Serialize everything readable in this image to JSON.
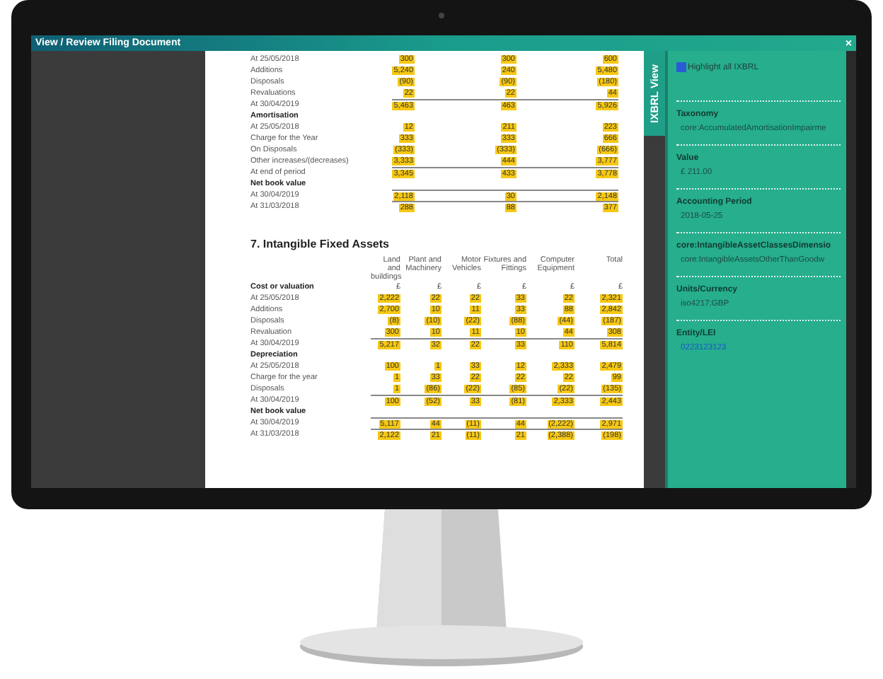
{
  "window": {
    "title": "View / Review Filing Document",
    "close": "×"
  },
  "document": {
    "table_1": {
      "rows": [
        {
          "kind": "value",
          "label": "At 25/05/2018",
          "values": [
            "300",
            "300",
            "600"
          ]
        },
        {
          "kind": "value",
          "label": "Additions",
          "values": [
            "5,240",
            "240",
            "5,480"
          ]
        },
        {
          "kind": "value",
          "label": "Disposals",
          "values": [
            "(90)",
            "(90)",
            "(180)"
          ]
        },
        {
          "kind": "value",
          "label": "Revaluations",
          "values": [
            "22",
            "22",
            "44"
          ]
        },
        {
          "kind": "total",
          "label": "At 30/04/2019",
          "values": [
            "5,463",
            "463",
            "5,926"
          ]
        },
        {
          "kind": "heading",
          "label": "Amortisation",
          "values": []
        },
        {
          "kind": "value",
          "label": "At 25/05/2018",
          "values": [
            "12",
            "211",
            "223"
          ]
        },
        {
          "kind": "value",
          "label": "Charge for the Year",
          "values": [
            "333",
            "333",
            "666"
          ]
        },
        {
          "kind": "value",
          "label": "On Disposals",
          "values": [
            "(333)",
            "(333)",
            "(666)"
          ]
        },
        {
          "kind": "value",
          "label": "Other increases/(decreases)",
          "values": [
            "3,333",
            "444",
            "3,777"
          ]
        },
        {
          "kind": "total",
          "label": "At end of period",
          "values": [
            "3,345",
            "433",
            "3,778"
          ]
        },
        {
          "kind": "heading",
          "label": "Net book value",
          "values": []
        },
        {
          "kind": "total",
          "label": "At 30/04/2019",
          "values": [
            "2,118",
            "30",
            "2,148"
          ]
        },
        {
          "kind": "total",
          "label": "At 31/03/2018",
          "values": [
            "288",
            "88",
            "377"
          ]
        }
      ]
    },
    "section_heading": "7. Intangible Fixed Assets",
    "table_2": {
      "columns": [
        "Land and buildings",
        "Plant and Machinery",
        "Motor Vehicles",
        "Fixtures and Fittings",
        "Computer Equipment",
        "Total"
      ],
      "rows": [
        {
          "kind": "heading",
          "label": "Cost or valuation",
          "values": [
            "£",
            "£",
            "£",
            "£",
            "£",
            "£"
          ]
        },
        {
          "kind": "value",
          "label": "At 25/05/2018",
          "values": [
            "2,222",
            "22",
            "22",
            "33",
            "22",
            "2,321"
          ]
        },
        {
          "kind": "value",
          "label": "Additions",
          "values": [
            "2,700",
            "10",
            "11",
            "33",
            "88",
            "2,842"
          ]
        },
        {
          "kind": "value",
          "label": "Disposals",
          "values": [
            "(8)",
            "(10)",
            "(22)",
            "(88)",
            "(44)",
            "(187)"
          ]
        },
        {
          "kind": "value",
          "label": "Revaluation",
          "values": [
            "300",
            "10",
            "11",
            "10",
            "44",
            "308"
          ]
        },
        {
          "kind": "total",
          "label": "At 30/04/2019",
          "values": [
            "5,217",
            "32",
            "22",
            "33",
            "110",
            "5,814"
          ]
        },
        {
          "kind": "heading",
          "label": "Depreciation",
          "values": []
        },
        {
          "kind": "value",
          "label": "At 25/05/2018",
          "values": [
            "100",
            "1",
            "33",
            "12",
            "2,333",
            "2,479"
          ]
        },
        {
          "kind": "value",
          "label": "Charge for the year",
          "values": [
            "1",
            "33",
            "22",
            "22",
            "22",
            "99"
          ]
        },
        {
          "kind": "value",
          "label": "Disposals",
          "values": [
            "1",
            "(86)",
            "(22)",
            "(85)",
            "(22)",
            "(135)"
          ]
        },
        {
          "kind": "total",
          "label": "At 30/04/2019",
          "values": [
            "100",
            "(52)",
            "33",
            "(81)",
            "2,333",
            "2,443"
          ]
        },
        {
          "kind": "heading",
          "label": "Net book value",
          "values": []
        },
        {
          "kind": "total",
          "label": "At 30/04/2019",
          "values": [
            "5,117",
            "44",
            "(11)",
            "44",
            "(2,222)",
            "2,971"
          ]
        },
        {
          "kind": "total",
          "label": "At 31/03/2018",
          "values": [
            "2,122",
            "21",
            "(11)",
            "21",
            "(2,388)",
            "(198)"
          ]
        }
      ]
    }
  },
  "ixbrl_tab": "IXBRL View",
  "panel": {
    "highlight": {
      "label": "Highlight all IXBRL",
      "checked": true
    },
    "fields": [
      {
        "kind": "text",
        "label": "Taxonomy",
        "value": "core:AccumulatedAmortisationImpairme"
      },
      {
        "kind": "text",
        "label": "Value",
        "value": "£ 211.00"
      },
      {
        "kind": "text",
        "label": "Accounting Period",
        "value": "2018-05-25"
      },
      {
        "kind": "text",
        "label": "core:IntangibleAssetClassesDimensio",
        "value": "core:IntangibleAssetsOtherThanGoodw"
      },
      {
        "kind": "text",
        "label": "Units/Currency",
        "value": "iso4217:GBP"
      },
      {
        "kind": "link",
        "label": "Entity/LEI",
        "value": "0223123123"
      }
    ]
  }
}
